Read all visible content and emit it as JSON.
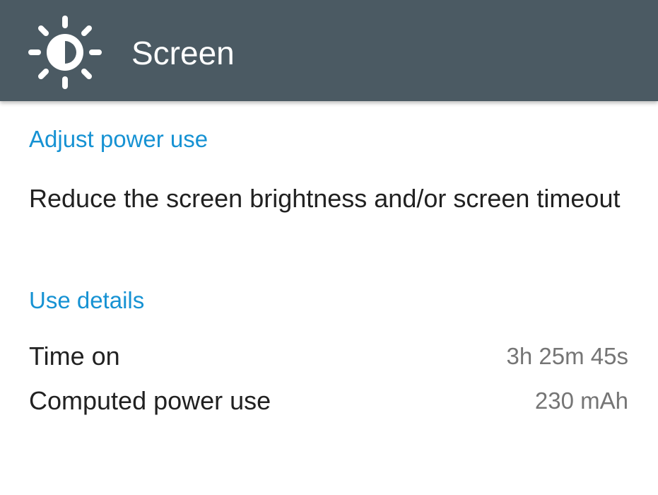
{
  "header": {
    "icon": "brightness-icon",
    "title": "Screen",
    "background_color": "#4b5a63"
  },
  "sections": {
    "adjust": {
      "title": "Adjust power use",
      "summary": "Reduce the screen brightness and/or screen timeout"
    },
    "use_details": {
      "title": "Use details",
      "rows": [
        {
          "label": "Time on",
          "value": "3h 25m 45s"
        },
        {
          "label": "Computed power use",
          "value": "230 mAh"
        }
      ]
    }
  },
  "colors": {
    "accent": "#1692d3",
    "primary_text": "#212121",
    "secondary_text": "#757575"
  }
}
